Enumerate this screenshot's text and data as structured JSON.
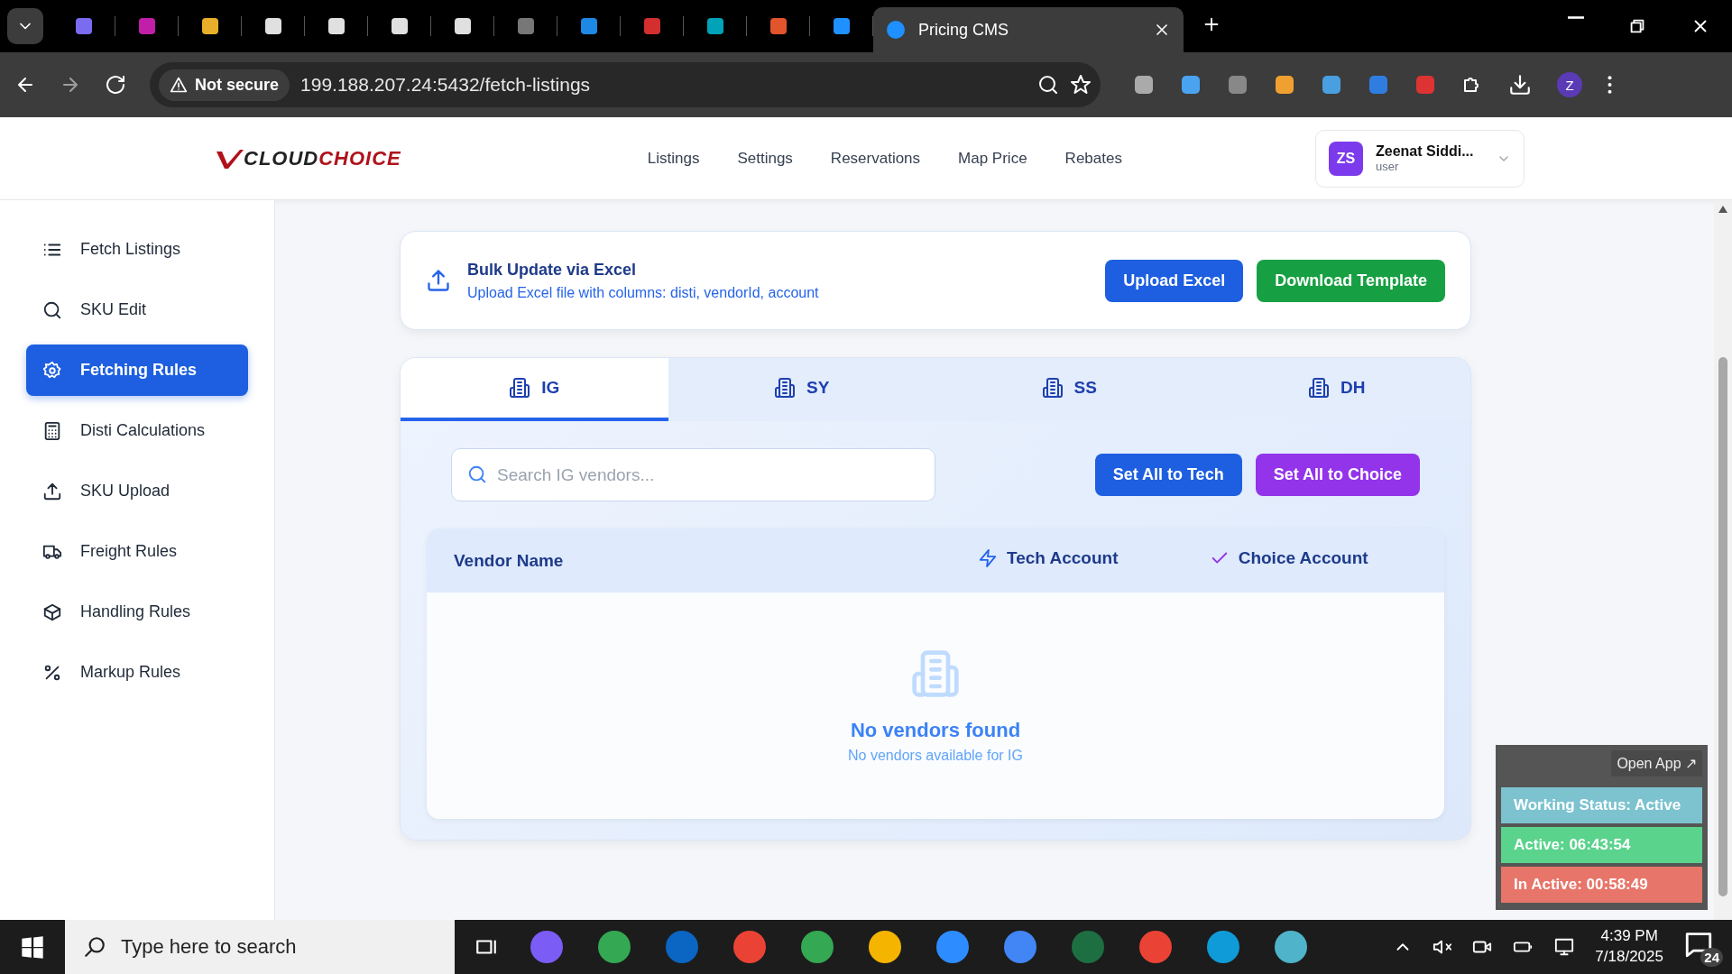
{
  "browser": {
    "active_tab": {
      "title": "Pricing CMS"
    },
    "security": "Not secure",
    "url": "199.188.207.24:5432/fetch-listings",
    "profile_initial": "Z"
  },
  "header": {
    "logo": {
      "first": "CLOUD",
      "second": "CHOICE"
    },
    "nav": [
      {
        "label": "Listings"
      },
      {
        "label": "Settings"
      },
      {
        "label": "Reservations"
      },
      {
        "label": "Map Price"
      },
      {
        "label": "Rebates"
      }
    ],
    "user": {
      "initials": "ZS",
      "name": "Zeenat Siddi...",
      "role": "user"
    }
  },
  "sidebar": {
    "items": [
      {
        "label": "Fetch Listings",
        "selected": false
      },
      {
        "label": "SKU Edit",
        "selected": false
      },
      {
        "label": "Fetching Rules",
        "selected": true
      },
      {
        "label": "Disti Calculations",
        "selected": false
      },
      {
        "label": "SKU Upload",
        "selected": false
      },
      {
        "label": "Freight Rules",
        "selected": false
      },
      {
        "label": "Handling Rules",
        "selected": false
      },
      {
        "label": "Markup Rules",
        "selected": false
      }
    ]
  },
  "bulk_update": {
    "title": "Bulk Update via Excel",
    "description": "Upload Excel file with columns: disti, vendorId, account",
    "buttons": [
      {
        "label": "Upload Excel",
        "kind": "primary"
      },
      {
        "label": "Download Template",
        "kind": "success"
      }
    ]
  },
  "tabs": [
    {
      "label": "IG",
      "selected": true
    },
    {
      "label": "SY",
      "selected": false
    },
    {
      "label": "SS",
      "selected": false
    },
    {
      "label": "DH",
      "selected": false
    }
  ],
  "search": {
    "placeholder": "Search IG vendors..."
  },
  "actions": [
    {
      "label": "Set All to Tech",
      "kind": "primary"
    },
    {
      "label": "Set All to Choice",
      "kind": "purple"
    }
  ],
  "table": {
    "columns": [
      {
        "label": "Vendor Name",
        "kind": "plain"
      },
      {
        "label": "Tech Account",
        "kind": "tech"
      },
      {
        "label": "Choice Account",
        "kind": "choice"
      }
    ],
    "empty": {
      "title": "No vendors found",
      "subtitle": "No vendors available for IG"
    }
  },
  "status_widget": {
    "open_button": "Open App ↗",
    "rows": [
      {
        "text": "Working Status: Active",
        "color": "#7cc3cf"
      },
      {
        "text": "Active: 06:43:54",
        "color": "#5ad38c"
      },
      {
        "text": "In Active: 00:58:49",
        "color": "#e8756a"
      }
    ]
  },
  "taskbar": {
    "search_placeholder": "Type here to search",
    "time": "4:39 PM",
    "date": "7/18/2025",
    "notifications": "24"
  }
}
